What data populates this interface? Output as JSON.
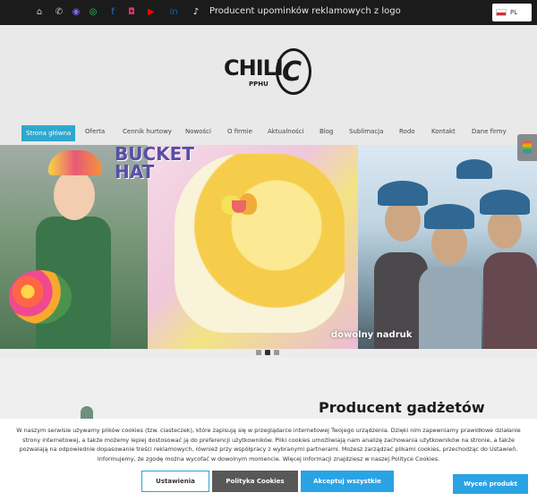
{
  "topbar": {
    "socials": [
      {
        "icon": "home-icon",
        "glyph": "⌂",
        "color": "#cccccc"
      },
      {
        "icon": "phone-icon",
        "glyph": "✆",
        "color": "#cccccc"
      },
      {
        "icon": "messenger-icon",
        "glyph": "◉",
        "color": "#7b6cf6"
      },
      {
        "icon": "whatsapp-icon",
        "glyph": "◎",
        "color": "#25d366"
      },
      {
        "icon": "facebook-icon",
        "glyph": "f",
        "color": "#1877f2"
      },
      {
        "icon": "instagram-icon",
        "glyph": "◘",
        "color": "#e1306c"
      },
      {
        "icon": "youtube-icon",
        "glyph": "▶",
        "color": "#ff0000"
      },
      {
        "icon": "linkedin-icon",
        "glyph": "in",
        "color": "#0a66c2"
      },
      {
        "icon": "tiktok-icon",
        "glyph": "♪",
        "color": "#ffffff"
      }
    ],
    "tagline": "Producent upominków reklamowych z logo",
    "language": {
      "code": "PL",
      "flag": "poland-flag-icon"
    }
  },
  "logo": {
    "word": "CHILI",
    "sub": "PPHU",
    "mark": "C"
  },
  "nav": {
    "items": [
      {
        "label": "Strona główna",
        "active": true
      },
      {
        "label": "Oferta"
      },
      {
        "label": "Cennik hurtowy"
      },
      {
        "label": "Nowości"
      },
      {
        "label": "O firmie"
      },
      {
        "label": "Aktualności"
      },
      {
        "label": "Blog"
      },
      {
        "label": "Sublimacja"
      },
      {
        "label": "Rodo"
      },
      {
        "label": "Kontakt"
      },
      {
        "label": "Dane firmy"
      }
    ],
    "accent": "#2fa7cf"
  },
  "slider": {
    "title_line1": "BUCKET",
    "title_line2": "HAT",
    "caption": "dowolny nadruk",
    "dots": 3,
    "active_dot": 1
  },
  "section": {
    "heading": "Producent gadżetów"
  },
  "cookie": {
    "text": "W naszym serwisie używamy plików cookies (tzw. ciasteczek), które zapisują się w przeglądarce internetowej Twojego urządzenia. Dzięki nim zapewniamy prawidłowe działanie strony internetowej, a także możemy lepiej dostosować ją do preferencji użytkowników. Pliki cookies umożliwiają nam analizę zachowania użytkowników na stronie, a także pozwalają na odpowiednie dopasowanie treści reklamowych, również przy współpracy z wybranymi partnerami. Możesz zarządzać plikami cookies, przechodząc do Ustawień. Informujemy, że zgodę można wycofać w dowolnym momencie. Więcej informacji znajdziesz w naszej Polityce Cookies.",
    "settings_label": "Ustawienia",
    "policy_label": "Polityka Cookies",
    "accept_label": "Akceptuj wszystkie"
  },
  "choose_button": "Wyceń produkt"
}
